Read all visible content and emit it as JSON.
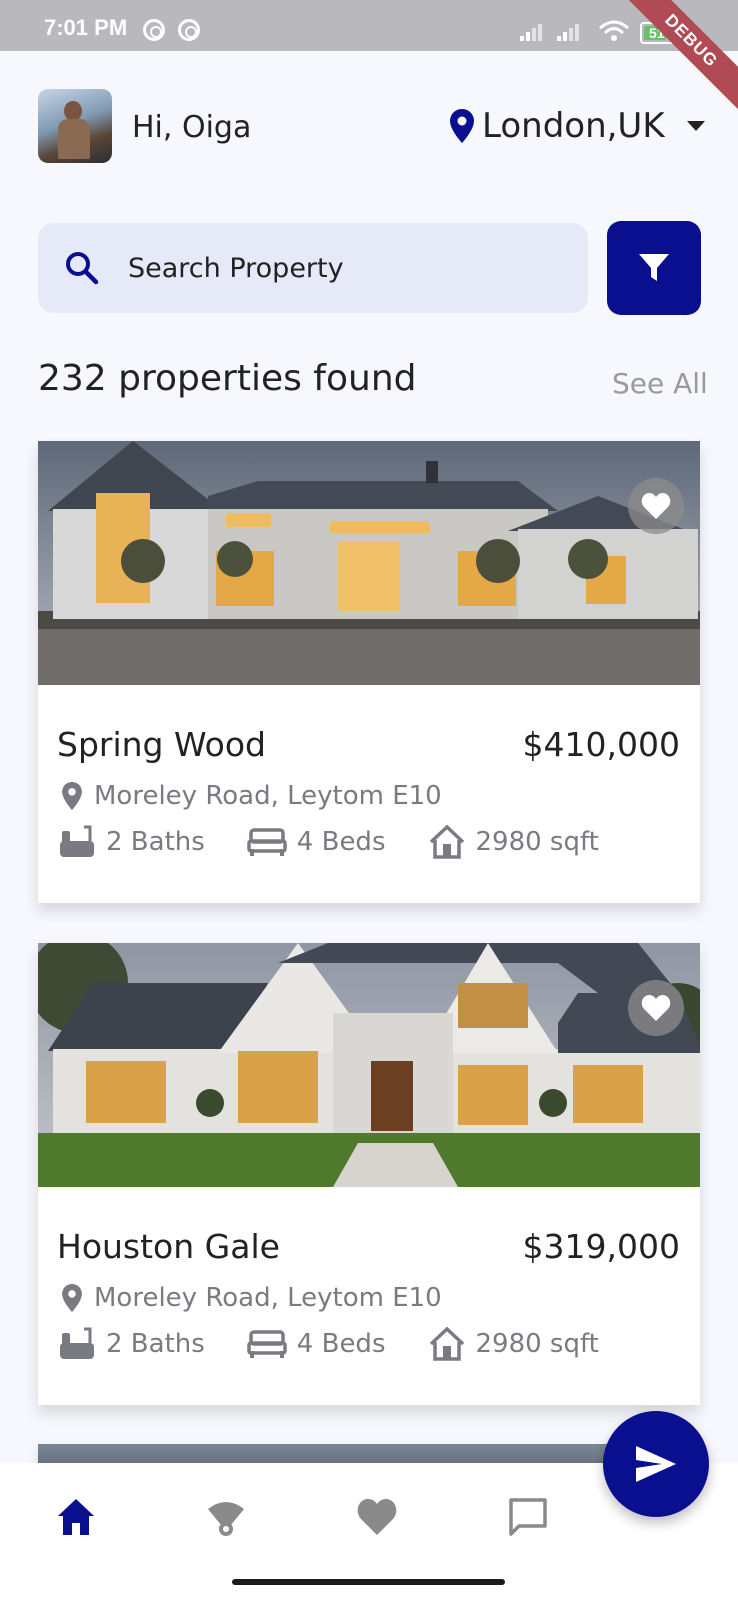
{
  "status_bar": {
    "time": "7:01 PM",
    "battery": "51",
    "debug_banner": "DEBUG"
  },
  "header": {
    "greeting": "Hi, Oiga",
    "location": "London,UK"
  },
  "search": {
    "placeholder": "Search Property"
  },
  "results": {
    "count_text": "232 properties found",
    "see_all": "See All"
  },
  "listings": [
    {
      "name": "Spring Wood",
      "price": "$410,000",
      "address": "Moreley Road, Leytom E10",
      "baths": "2 Baths",
      "beds": "4 Beds",
      "area": "2980 sqft"
    },
    {
      "name": "Houston Gale",
      "price": "$319,000",
      "address": "Moreley Road, Leytom E10",
      "baths": "2 Baths",
      "beds": "4 Beds",
      "area": "2980 sqft"
    }
  ],
  "colors": {
    "accent": "#0a0f8f",
    "search_bg": "#e6eaf8",
    "muted_text": "#7a7a82",
    "page_bg": "#f7f8fd"
  },
  "nav": {
    "items": [
      "home-icon",
      "wifi-icon",
      "heart-icon",
      "chat-icon"
    ],
    "fab_icon": "send-icon"
  }
}
